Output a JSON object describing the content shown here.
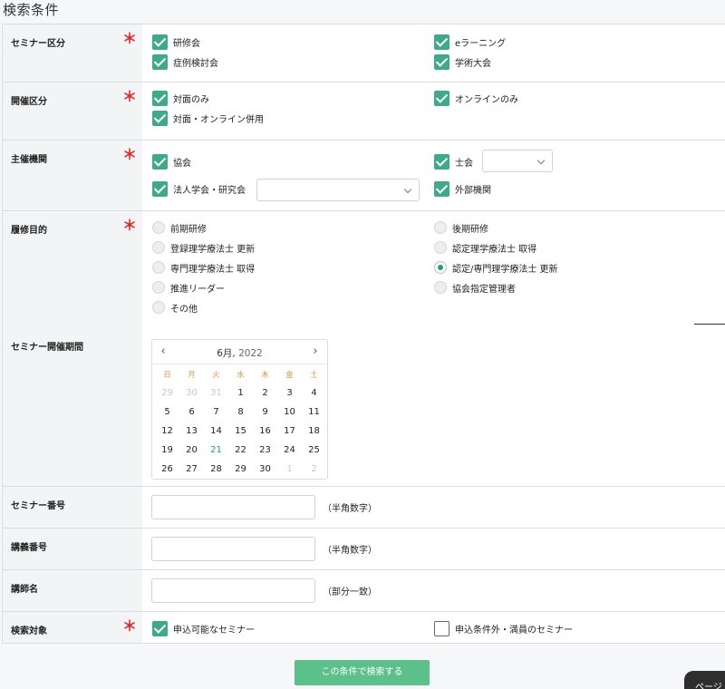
{
  "page_title": "検索条件",
  "seminar_type": {
    "label": "セミナー区分",
    "required_mark": "＊",
    "options": [
      {
        "label": "研修会",
        "checked": true
      },
      {
        "label": "eラーニング",
        "checked": true
      },
      {
        "label": "症例検討会",
        "checked": true
      },
      {
        "label": "学術大会",
        "checked": true
      }
    ]
  },
  "held_type": {
    "label": "開催区分",
    "required_mark": "＊",
    "options": [
      {
        "label": "対面のみ",
        "checked": true
      },
      {
        "label": "オンラインのみ",
        "checked": true
      },
      {
        "label": "対面・オンライン併用",
        "checked": true
      }
    ]
  },
  "organizer": {
    "label": "主催機関",
    "required_mark": "＊",
    "options": [
      {
        "label": "協会",
        "checked": true
      },
      {
        "label": "士会",
        "checked": true
      },
      {
        "label": "法人学会・研究会",
        "checked": true
      },
      {
        "label": "外部機関",
        "checked": true
      }
    ],
    "shikai_select_value": "",
    "gakkai_select_value": ""
  },
  "purpose": {
    "label": "履修目的",
    "required_mark": "＊",
    "options": [
      {
        "label": "前期研修",
        "selected": false
      },
      {
        "label": "後期研修",
        "selected": false
      },
      {
        "label": "登録理学療法士 更新",
        "selected": false
      },
      {
        "label": "認定理学療法士 取得",
        "selected": false
      },
      {
        "label": "専門理学療法士 取得",
        "selected": false
      },
      {
        "label": "認定/専門理学療法士 更新",
        "selected": true
      },
      {
        "label": "推進リーダー",
        "selected": false
      },
      {
        "label": "協会指定管理者",
        "selected": false
      },
      {
        "label": "その他",
        "selected": false
      }
    ]
  },
  "period": {
    "label": "セミナー開催期間",
    "calendar": {
      "prev": "‹",
      "next": "›",
      "month": "6月,",
      "year": "2022",
      "weekdays": [
        "日",
        "月",
        "火",
        "水",
        "木",
        "金",
        "土"
      ],
      "weeks": [
        [
          "29",
          "30",
          "31",
          "1",
          "2",
          "3",
          "4"
        ],
        [
          "5",
          "6",
          "7",
          "8",
          "9",
          "10",
          "11"
        ],
        [
          "12",
          "13",
          "14",
          "15",
          "16",
          "17",
          "18"
        ],
        [
          "19",
          "20",
          "21",
          "22",
          "23",
          "24",
          "25"
        ],
        [
          "26",
          "27",
          "28",
          "29",
          "30",
          "1",
          "2"
        ]
      ],
      "today": "21"
    }
  },
  "seminar_number": {
    "label": "セミナー番号",
    "value": "",
    "hint": "（半角数字）"
  },
  "lecture_number": {
    "label": "講義番号",
    "value": "",
    "hint": "（半角数字）"
  },
  "instructor_name": {
    "label": "講師名",
    "value": "",
    "hint": "（部分一致）"
  },
  "target": {
    "label": "検索対象",
    "required_mark": "＊",
    "options": [
      {
        "label": "申込可能なセミナー",
        "checked": true
      },
      {
        "label": "申込条件外・満員のセミナー",
        "checked": false
      }
    ]
  },
  "submit_label": "この条件で検索する",
  "floating_tab_label": "ページ"
}
